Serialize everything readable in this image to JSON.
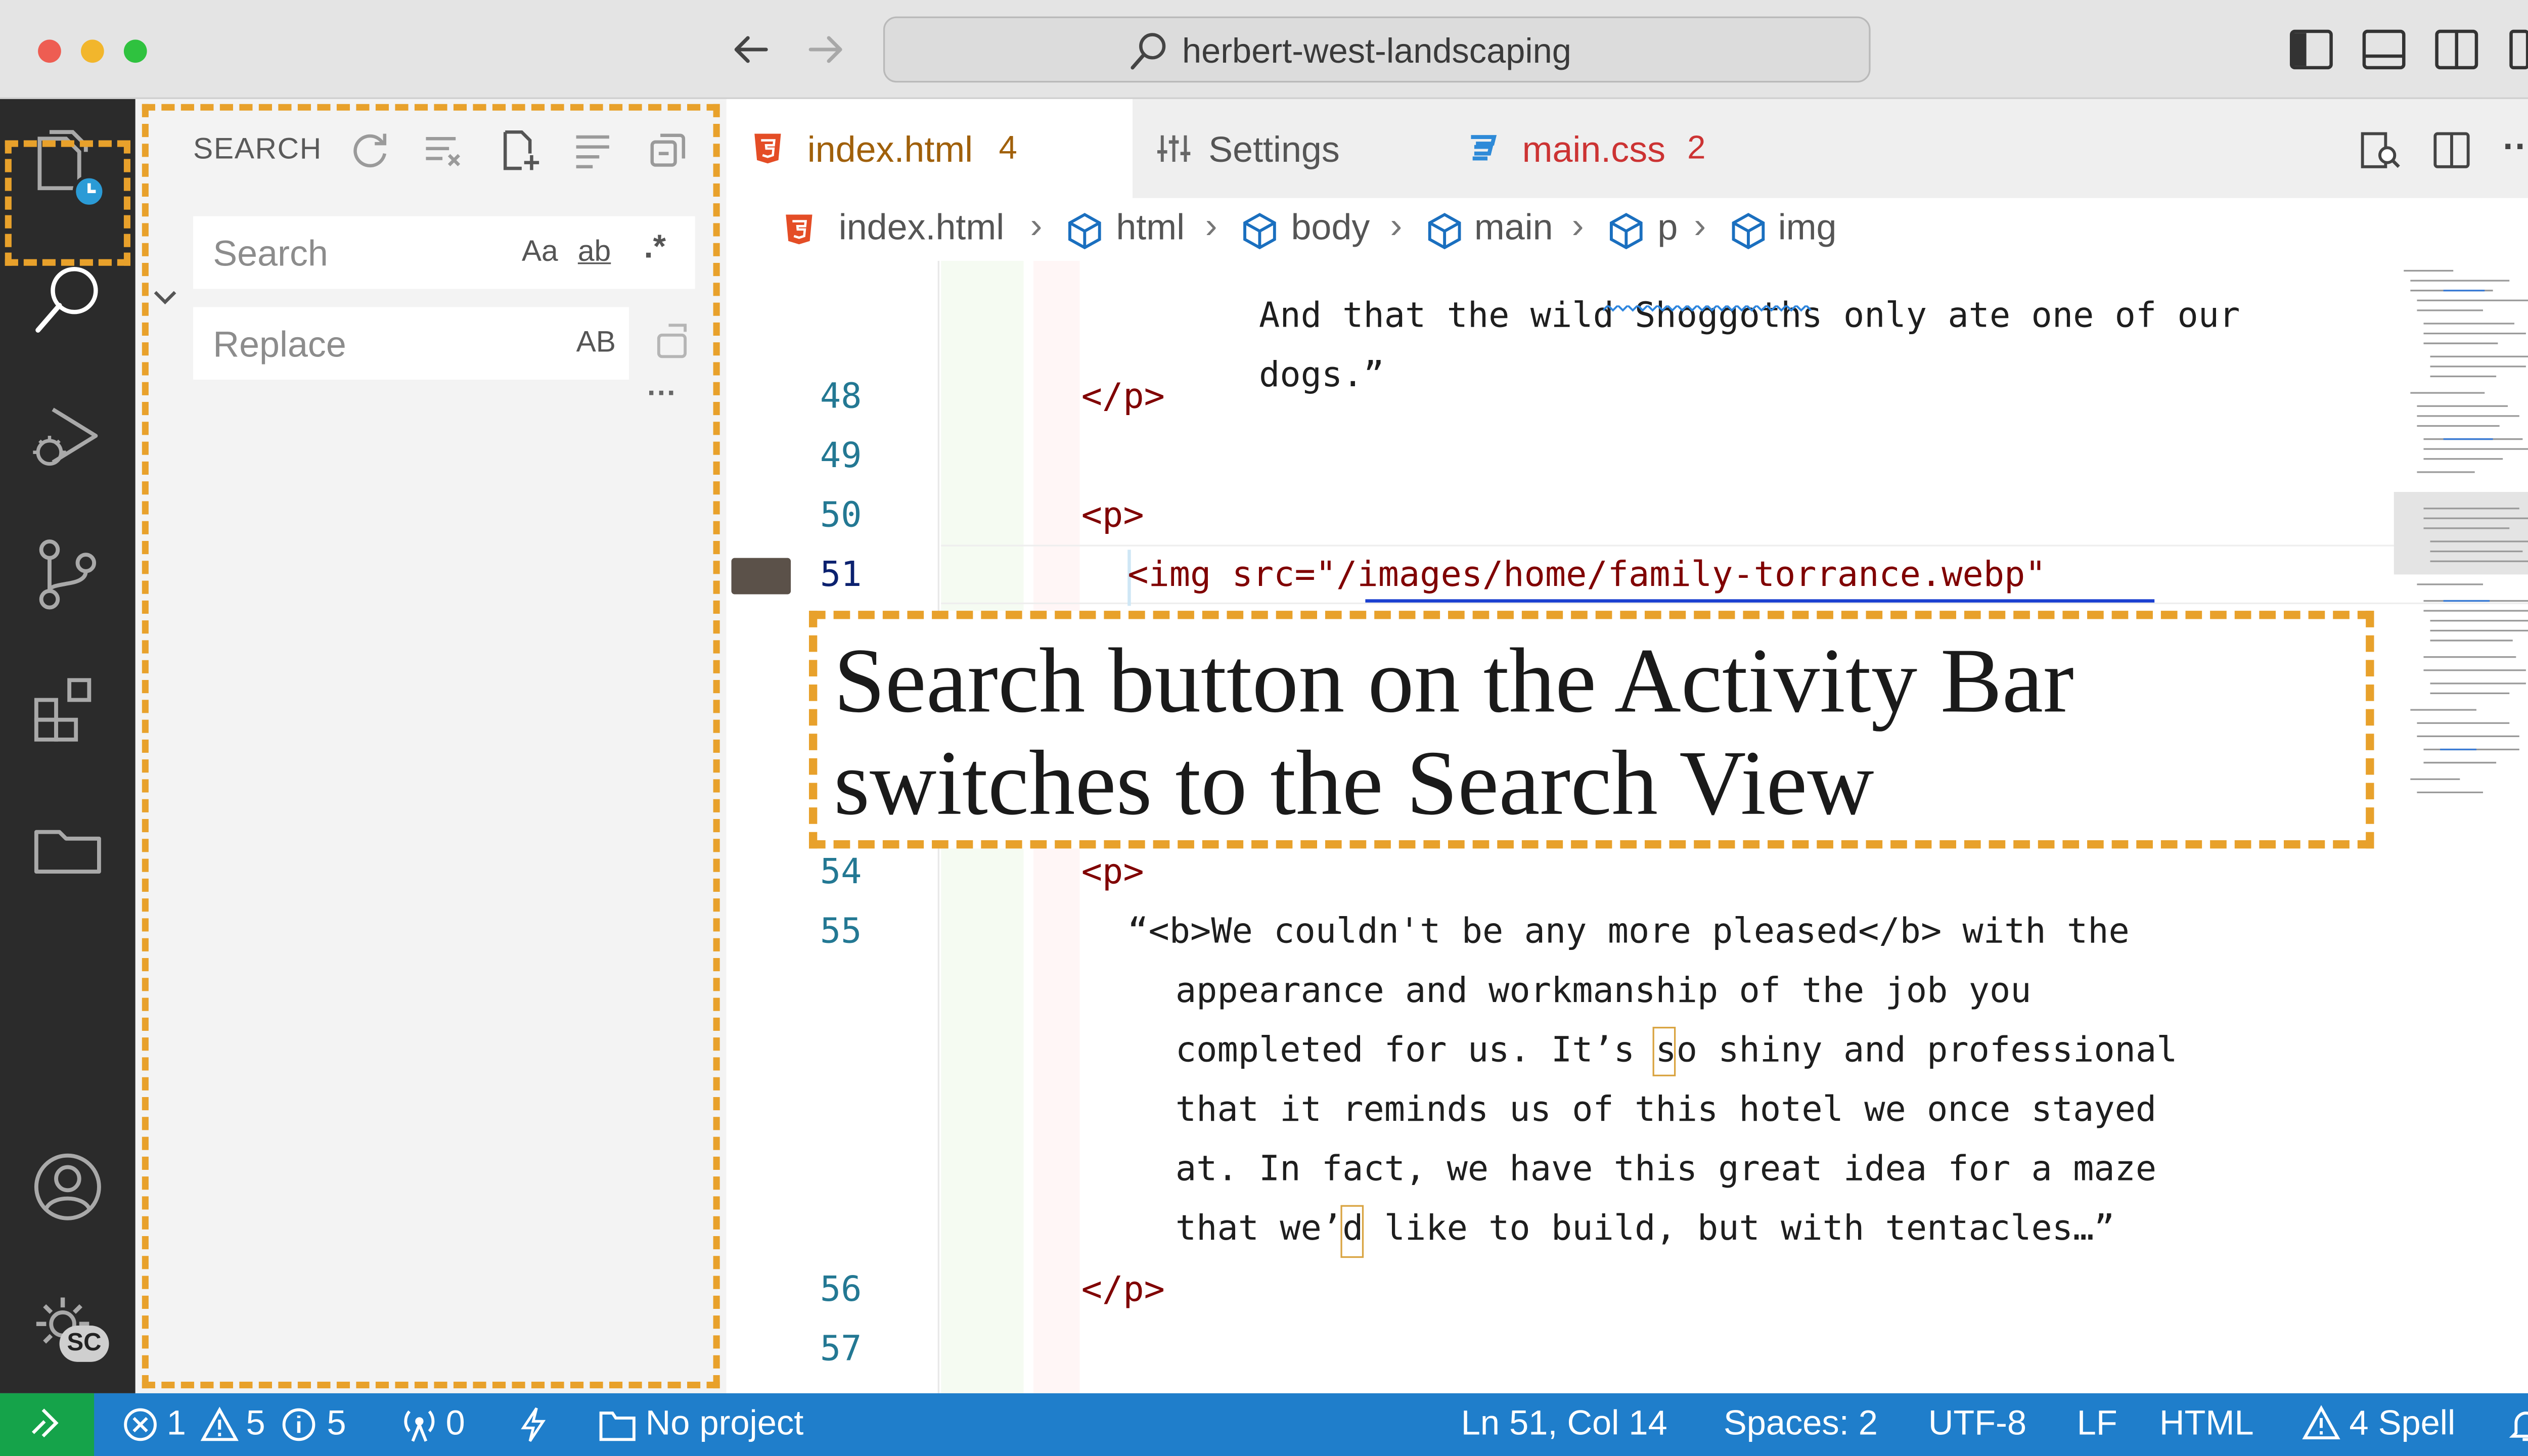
{
  "window": {
    "title": "herbert-west-landscaping",
    "traffic_colors": [
      "#ee5d52",
      "#f2b62c",
      "#2fc23f"
    ]
  },
  "sidebar": {
    "title": "SEARCH",
    "search_placeholder": "Search",
    "replace_placeholder": "Replace",
    "opt_case": "Aa",
    "opt_word": "ab",
    "opt_regex": ".*",
    "opt_preserve_case": "AB",
    "more": "···"
  },
  "tabs": [
    {
      "label": "index.html",
      "count": "4",
      "color": "#a0600a"
    },
    {
      "label": "Settings",
      "count": "",
      "color": "#555555"
    },
    {
      "label": "main.css",
      "count": "2",
      "color": "#cc3333"
    }
  ],
  "breadcrumbs": [
    "index.html",
    "html",
    "body",
    "main",
    "p",
    "img"
  ],
  "code_lines": [
    {
      "num": "",
      "text": "And that the wild Shoggoths only ate one of our"
    },
    {
      "num": "",
      "text": "dogs.”"
    },
    {
      "num": "48",
      "text": "</p>"
    },
    {
      "num": "49",
      "text": ""
    },
    {
      "num": "50",
      "text": "<p>"
    },
    {
      "num": "51",
      "text": "<img src=\"/images/home/family-torrance.webp\""
    },
    {
      "num": "54",
      "text": "<p>"
    },
    {
      "num": "55",
      "text": "“<b>We couldn't be any more pleased</b> with the"
    },
    {
      "num": "",
      "text": "appearance and workmanship of the job you"
    },
    {
      "num": "",
      "text": "completed for us. It’s so shiny and professional"
    },
    {
      "num": "",
      "text": "that it reminds us of this hotel we once stayed"
    },
    {
      "num": "",
      "text": "at. In fact, we have this great idea for a maze"
    },
    {
      "num": "",
      "text": "that we’d like to build, but with tentacles…”"
    },
    {
      "num": "56",
      "text": "</p>"
    },
    {
      "num": "57",
      "text": ""
    }
  ],
  "callout": {
    "line1": "Search button on the Activity Bar",
    "line2": "switches to the Search View"
  },
  "status": {
    "errors": "1",
    "warnings": "5",
    "infos": "5",
    "ports": "0",
    "project": "No project",
    "position": "Ln 51, Col 14",
    "spaces": "Spaces: 2",
    "encoding": "UTF-8",
    "eol": "LF",
    "language": "HTML",
    "spell": "4 Spell"
  },
  "account_badge": "SC",
  "accent_color": "#e8a12b",
  "statusbar_color": "#1f7ecb"
}
